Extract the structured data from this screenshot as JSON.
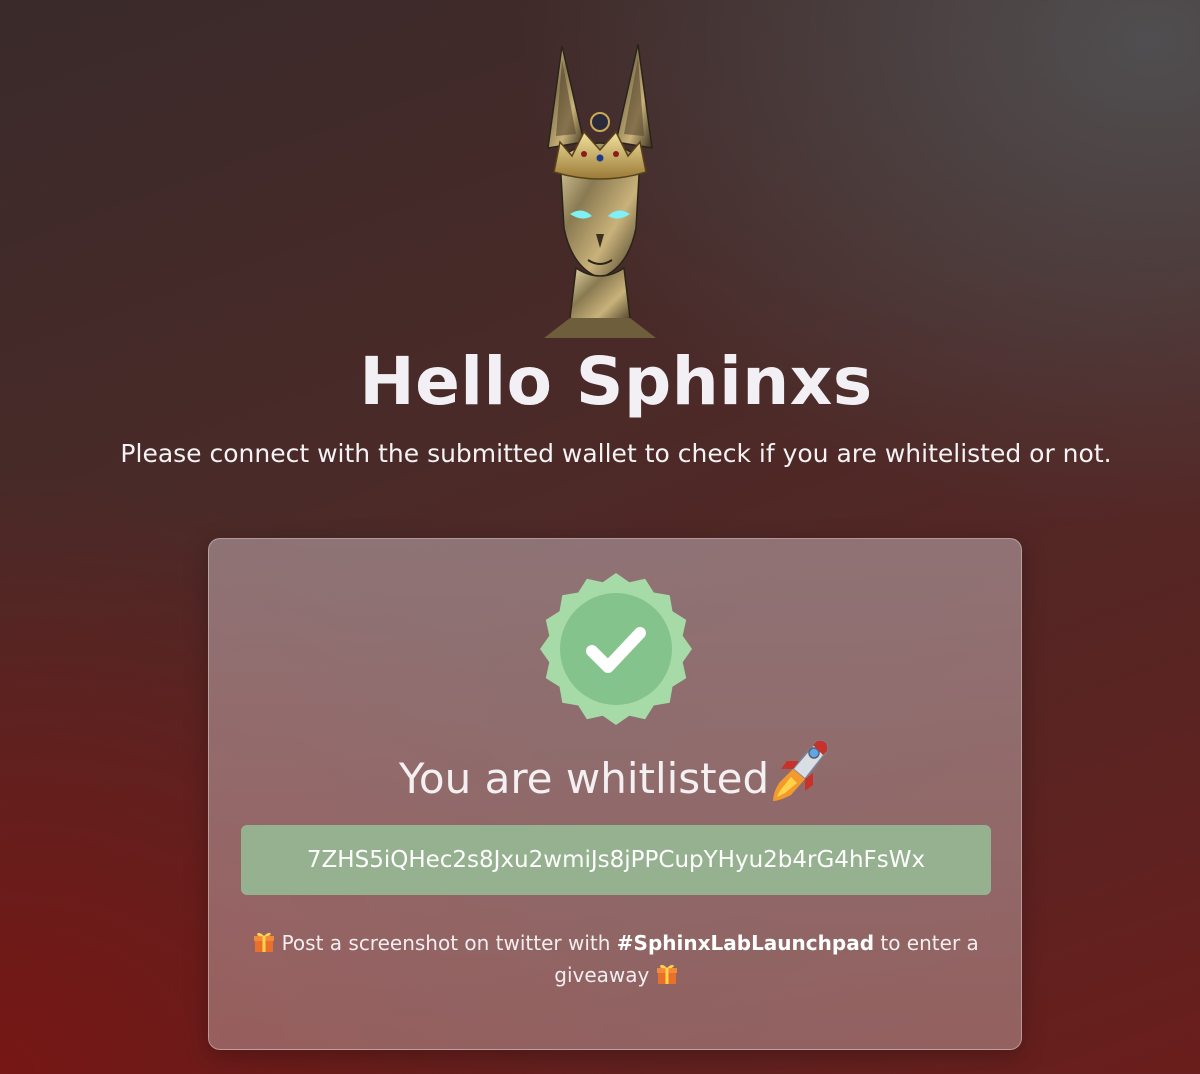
{
  "header": {
    "avatar_icon": "sphinx-cat-crown-icon",
    "title": "Hello Sphinxs",
    "subtitle": "Please connect with the submitted wallet to check if you are whitelisted or not."
  },
  "result_card": {
    "badge_icon": "verified-check-badge-icon",
    "status_text": "You are whitlisted",
    "status_emoji": "rocket-icon",
    "wallet_address": "7ZHS5iQHec2s8Jxu2wmiJs8jPPCupYHyu2b4rG4hFsWx",
    "note_prefix": "Post a screenshot on twitter with",
    "note_hashtag": "#SphinxLabLaunchpad",
    "note_suffix": "to enter a giveaway",
    "gift_icon": "gift-icon"
  },
  "colors": {
    "badge_outer": "#a6dba8",
    "badge_inner": "#84c38b",
    "wallet_bg": "#96be96",
    "title_text": "#f2f0f4"
  }
}
